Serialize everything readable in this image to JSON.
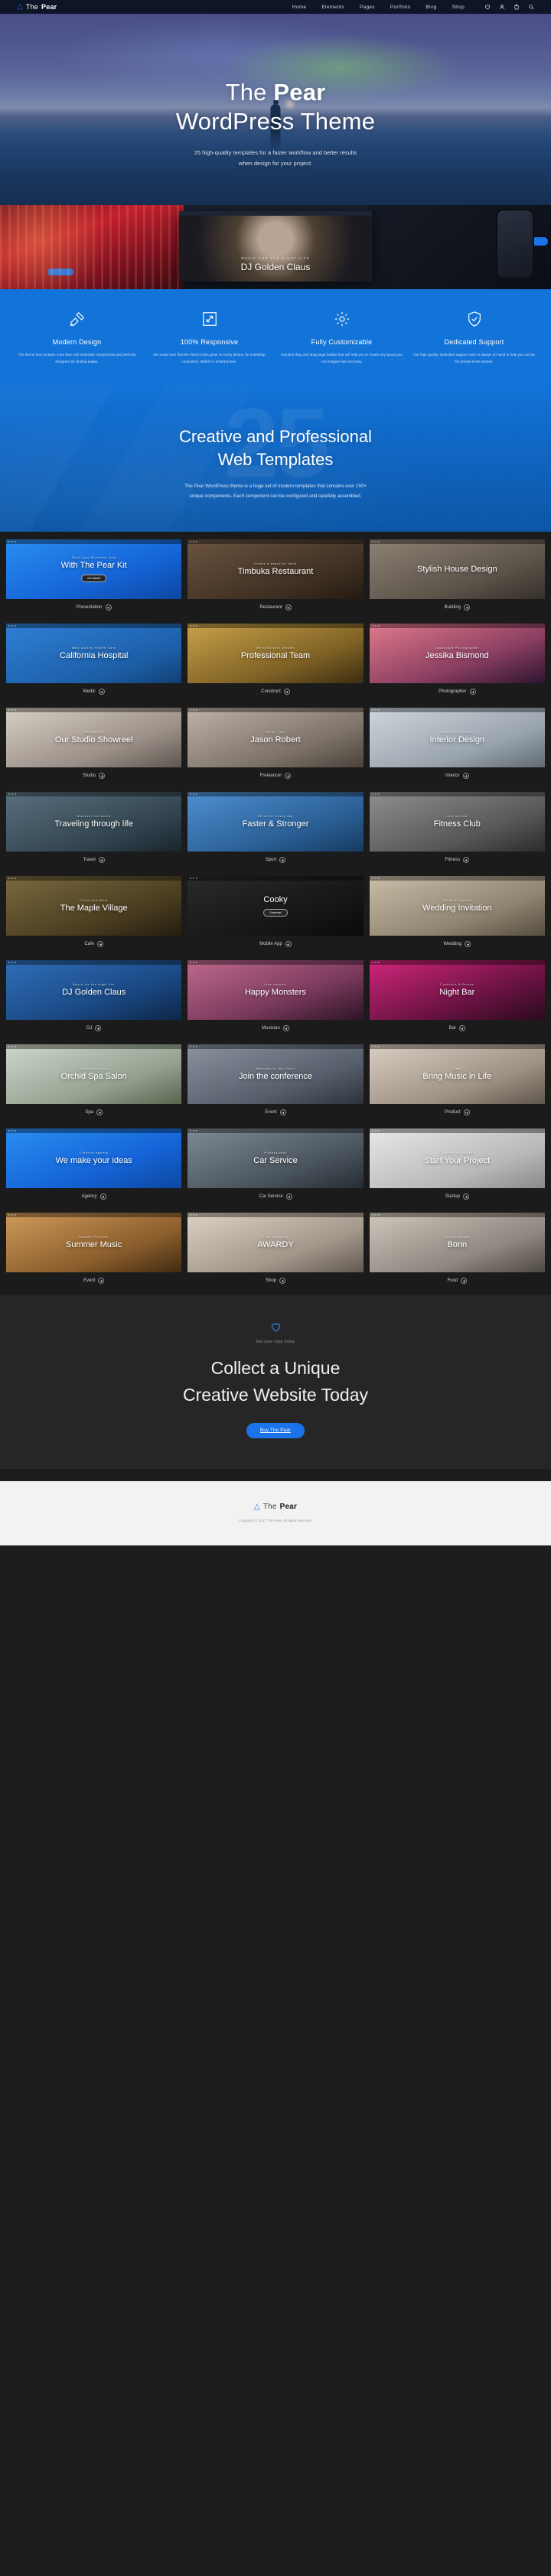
{
  "header": {
    "brand": {
      "mark": "triangle-logo",
      "light": "The",
      "bold": "Pear"
    },
    "nav": [
      {
        "label": "Home"
      },
      {
        "label": "Elements"
      },
      {
        "label": "Pages"
      },
      {
        "label": "Portfolio"
      },
      {
        "label": "Blog"
      },
      {
        "label": "Shop"
      }
    ],
    "icons": [
      "heart-icon",
      "user-icon",
      "bag-icon",
      "search-icon"
    ]
  },
  "hero": {
    "title_light": "The ",
    "title_bold": "Pear",
    "title_line2": "WordPress Theme",
    "subtitle_line1": "25 high-quality templates for a faster workflow and better results",
    "subtitle_line2": "when design for your project."
  },
  "showcase": {
    "kicker": "Music for the night life",
    "title": "DJ Golden Claus"
  },
  "features": [
    {
      "icon": "pencil-ruler-icon",
      "title": "Modern Design",
      "text": "The theme that contains more than 150 elaborate components and perfectly designed 25 landing pages."
    },
    {
      "icon": "expand-arrows-icon",
      "title": "100% Responsive",
      "text": "We made sure that the theme looks great on every device, be it desktop computers, tablets or smartphones."
    },
    {
      "icon": "gear-icon",
      "title": "Fully Customizable",
      "text": "Includes drag and drop page builder that will help you to create any layout you can imagine fast and easy."
    },
    {
      "icon": "shield-check-icon",
      "title": "Dedicated Support",
      "text": "Our high quality, dedicated support team is always on hand to help you out via the private ticket system."
    }
  ],
  "intro": {
    "watermark": "25",
    "title_line1": "Creative and Professional",
    "title_line2": "Web Templates",
    "text_line1": "The Pear WordPress theme is a huge set of modern templates that contains over 150+",
    "text_line2": "unique components. Each component can be configured and carefully assembled."
  },
  "templates": [
    {
      "label": "Presentation",
      "kicker": "Start your Business Now",
      "title": "With The Pear Kit",
      "cta": "Get Started",
      "tone": "presentation"
    },
    {
      "label": "Restaurant",
      "kicker": "Create a beautiful taste",
      "title": "Timbuka Restaurant",
      "cta": "",
      "tone": "restaurant"
    },
    {
      "label": "Building",
      "kicker": "",
      "title": "Stylish House Design",
      "cta": "",
      "tone": "building"
    },
    {
      "label": "Medic",
      "kicker": "Best quality Health Care",
      "title": "California Hospital",
      "cta": "",
      "tone": "medic"
    },
    {
      "label": "Construct",
      "kicker": "We build your dreams",
      "title": "Professional Team",
      "cta": "",
      "tone": "construct"
    },
    {
      "label": "Photographer",
      "kicker": "Landscape Photographer",
      "title": "Jessika Bismond",
      "cta": "",
      "tone": "photographer"
    },
    {
      "label": "Studio",
      "kicker": "Welcome to",
      "title": "Our Studio Showreel",
      "cta": "",
      "tone": "studio"
    },
    {
      "label": "Freelancer",
      "kicker": "Hello, I am",
      "title": "Jason Robert",
      "cta": "",
      "tone": "freelancer"
    },
    {
      "label": "Interior",
      "kicker": "Modern and Clean",
      "title": "Interior Design",
      "cta": "",
      "tone": "interior"
    },
    {
      "label": "Travel",
      "kicker": "Discover the world",
      "title": "Traveling through life",
      "cta": "",
      "tone": "travel"
    },
    {
      "label": "Sport",
      "kicker": "Be better every day",
      "title": "Faster & Stronger",
      "cta": "",
      "tone": "sport"
    },
    {
      "label": "Fitness",
      "kicker": "Join us now",
      "title": "Fitness Club",
      "cta": "",
      "tone": "fitness"
    },
    {
      "label": "Cafe",
      "kicker": "Fresh and tasty",
      "title": "The Maple Village",
      "cta": "",
      "tone": "cafe"
    },
    {
      "label": "Mobile App",
      "kicker": "",
      "title": "Cooky",
      "cta": "Download",
      "tone": "mobileapp"
    },
    {
      "label": "Wedding",
      "kicker": "Ethan & Sophia",
      "title": "Wedding Invitation",
      "cta": "",
      "tone": "wedding"
    },
    {
      "label": "DJ",
      "kicker": "Music for the night life",
      "title": "DJ Golden Claus",
      "cta": "",
      "tone": "dj"
    },
    {
      "label": "Musician",
      "kicker": "Live concert",
      "title": "Happy Monsters",
      "cta": "",
      "tone": "musician"
    },
    {
      "label": "Bar",
      "kicker": "Cocktails & Drinks",
      "title": "Night Bar",
      "cta": "",
      "tone": "bar"
    },
    {
      "label": "Spa",
      "kicker": "Relax your body",
      "title": "Orchid Spa Salon",
      "cta": "",
      "tone": "spa"
    },
    {
      "label": "Event",
      "kicker": "Welcome to the Event",
      "title": "Join the conference",
      "cta": "",
      "tone": "event"
    },
    {
      "label": "Product",
      "kicker": "New",
      "title": "Bring Music in Life",
      "cta": "",
      "tone": "product"
    },
    {
      "label": "Agency",
      "kicker": "Creative Agency",
      "title": "We make your ideas",
      "cta": "",
      "tone": "agency"
    },
    {
      "label": "Car Service",
      "kicker": "Professional",
      "title": "Car Service",
      "cta": "",
      "tone": "carservice"
    },
    {
      "label": "Startup",
      "kicker": "Creative Workspace",
      "title": "Start Your Project",
      "cta": "",
      "tone": "startup"
    },
    {
      "label": "Event",
      "kicker": "Summer Festival",
      "title": "Summer Music",
      "cta": "",
      "tone": "festival"
    },
    {
      "label": "Shop",
      "kicker": "Fine shopping",
      "title": "AWARDY",
      "cta": "",
      "tone": "shop"
    },
    {
      "label": "Food",
      "kicker": "Delicious food",
      "title": "Bonn",
      "cta": "",
      "tone": "food"
    }
  ],
  "cta": {
    "icon": "heart-icon",
    "small": "Get your copy today",
    "title_line1": "Collect a Unique",
    "title_line2": "Creative Website Today",
    "button": "Buy The Pear"
  },
  "footer": {
    "brand_light": "The",
    "brand_bold": "Pear",
    "copyright": "Copyright © 2017 The Pear. All rights reserved."
  },
  "colors": {
    "accent": "#1a73e8",
    "feature_bg": "#1273d8",
    "dark_bg": "#1b1b1b",
    "cta_bg": "#262626",
    "footer_bg": "#f2f2f2"
  }
}
